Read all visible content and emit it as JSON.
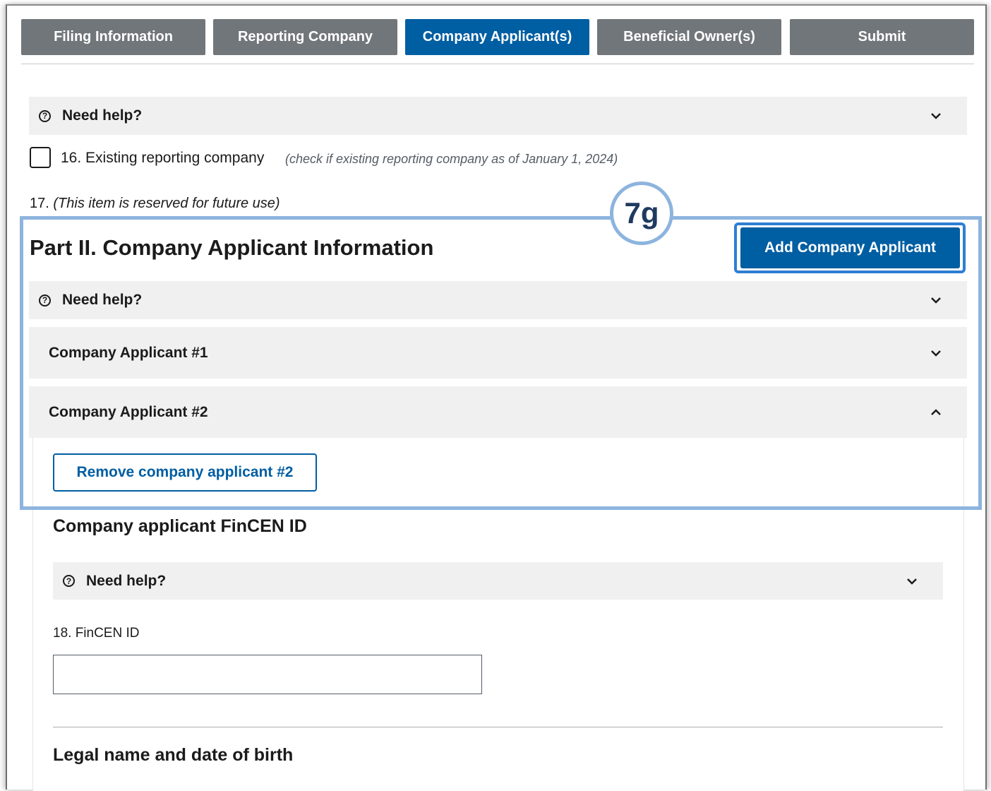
{
  "tabs": [
    {
      "label": "Filing Information",
      "active": false
    },
    {
      "label": "Reporting Company",
      "active": false
    },
    {
      "label": "Company Applicant(s)",
      "active": true
    },
    {
      "label": "Beneficial Owner(s)",
      "active": false
    },
    {
      "label": "Submit",
      "active": false
    }
  ],
  "help": {
    "icon": "question-circle-icon",
    "label": "Need help?"
  },
  "item16": {
    "label": "16. Existing reporting company",
    "hint": "(check if existing reporting company as of January 1, 2024)",
    "checked": false
  },
  "item17": {
    "number": "17.",
    "text": "(This item is reserved for future use)"
  },
  "annotation_badge": "7g",
  "part2": {
    "title": "Part II. Company Applicant Information",
    "add_button": "Add Company Applicant",
    "applicants": [
      {
        "label": "Company Applicant #1",
        "expanded": false
      },
      {
        "label": "Company Applicant #2",
        "expanded": true
      }
    ],
    "remove_button": "Remove company applicant #2"
  },
  "fincen": {
    "heading": "Company applicant FinCEN ID",
    "field_label": "18. FinCEN ID",
    "field_value": ""
  },
  "legal_heading": "Legal name and date of birth",
  "colors": {
    "accent": "#005ea2",
    "tab_inactive": "#71767a",
    "annotation": "#8db4de"
  }
}
